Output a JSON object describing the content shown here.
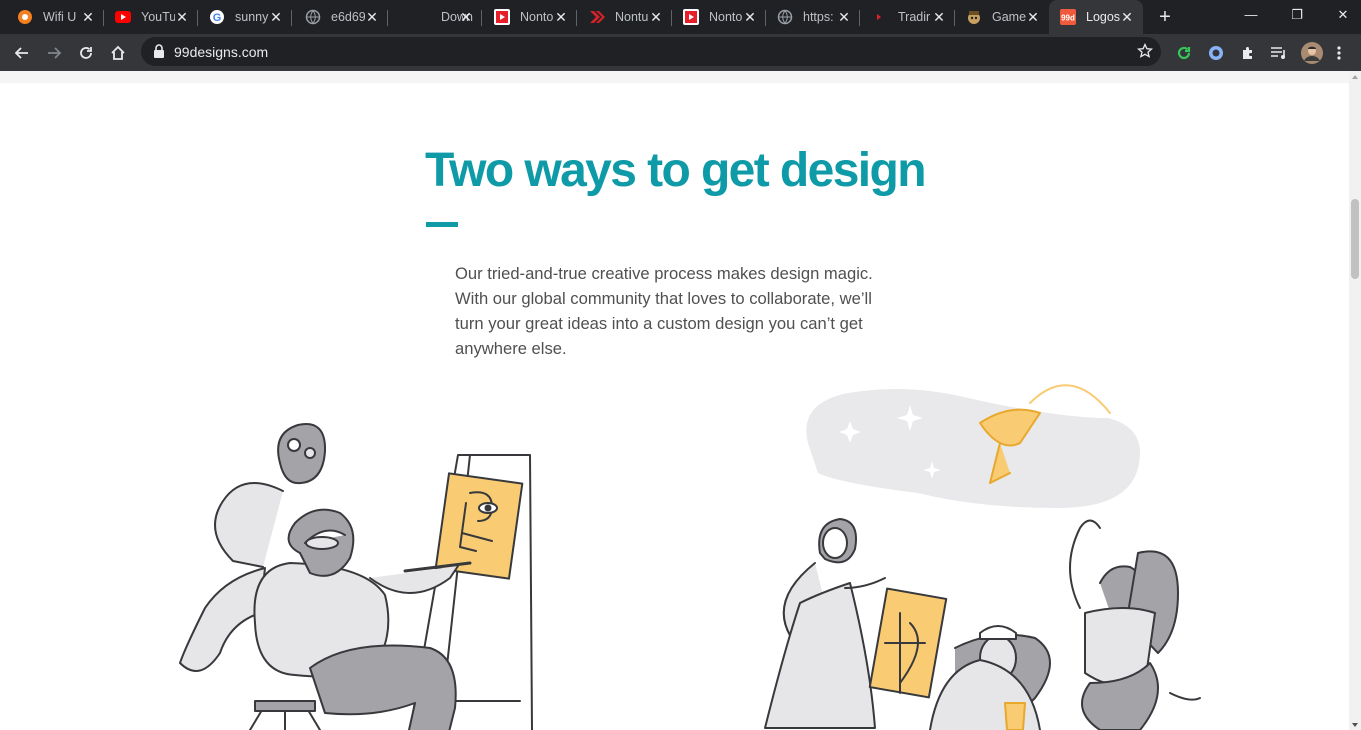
{
  "browser": {
    "tabs": [
      {
        "label": "Wifi U",
        "icon": "orange-q-icon",
        "active": false
      },
      {
        "label": "YouTu",
        "icon": "youtube-icon",
        "active": false
      },
      {
        "label": "sunny",
        "icon": "google-icon",
        "active": false
      },
      {
        "label": "e6d69",
        "icon": "globe-icon",
        "active": false
      },
      {
        "label": "Down",
        "icon": "none",
        "active": false
      },
      {
        "label": "Nonto",
        "icon": "red-play-icon",
        "active": false
      },
      {
        "label": "Nontu",
        "icon": "red-chevron-icon",
        "active": false
      },
      {
        "label": "Nonto",
        "icon": "red-play-icon",
        "active": false
      },
      {
        "label": "https:",
        "icon": "globe-icon",
        "active": false
      },
      {
        "label": "Tradir",
        "icon": "red-arrow-icon",
        "active": false
      },
      {
        "label": "Game",
        "icon": "game-icon",
        "active": false
      },
      {
        "label": "Logos",
        "icon": "99designs-icon",
        "active": true
      }
    ],
    "new_tab": "+",
    "window_controls": {
      "minimize": "—",
      "restore": "❐",
      "close": "✕"
    },
    "address": "99designs.com"
  },
  "page": {
    "headline": "Two ways to get design",
    "intro": "Our tried-and-true creative process makes design magic. With our global community that loves to collaborate, we’ll turn your great ideas into a custom design you can’t get anywhere else.",
    "colors": {
      "accent": "#0e9aa7",
      "text": "#505050",
      "illustration_gray": "#a4a4a8",
      "illustration_yellow": "#f9cb72"
    }
  }
}
